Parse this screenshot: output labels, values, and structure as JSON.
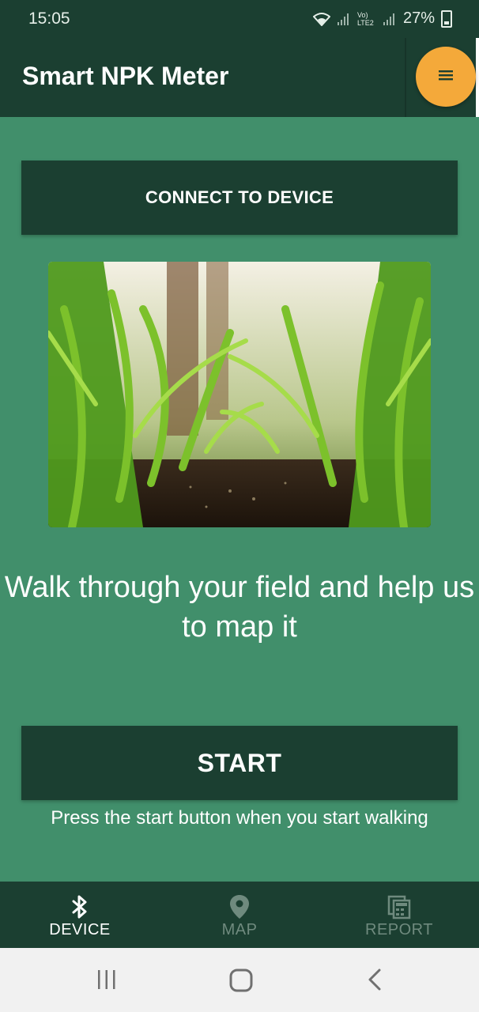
{
  "status_bar": {
    "time": "15:05",
    "battery": "27%",
    "network_label": "Vo) LTE2"
  },
  "app": {
    "title": "Smart NPK Meter",
    "menu_icon": "menu-icon"
  },
  "main": {
    "connect_label": "CONNECT TO DEVICE",
    "headline": "Walk through your field and help us to map it",
    "start_label": "START",
    "hint": "Press the start button when you start walking"
  },
  "bottom_nav": {
    "items": [
      {
        "label": "DEVICE",
        "icon": "bluetooth-icon",
        "active": true
      },
      {
        "label": "MAP",
        "icon": "map-pin-icon",
        "active": false
      },
      {
        "label": "REPORT",
        "icon": "report-icon",
        "active": false
      }
    ]
  },
  "colors": {
    "primary_dark": "#1b3f31",
    "background": "#418f6b",
    "accent": "#f4a93a"
  }
}
